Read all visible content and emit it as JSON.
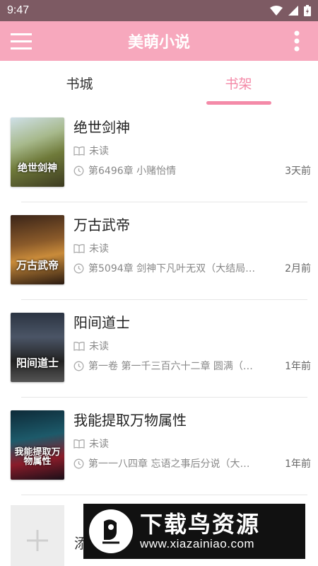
{
  "status": {
    "time": "9:47"
  },
  "app": {
    "title": "美萌小说"
  },
  "tabs": [
    {
      "label": "书城",
      "active": false
    },
    {
      "label": "书架",
      "active": true
    }
  ],
  "books": [
    {
      "title": "绝世剑神",
      "status": "未读",
      "chapter": "第6496章 小赌怡情",
      "time": "3天前",
      "cover_text": "绝世剑神",
      "cover_author": ""
    },
    {
      "title": "万古武帝",
      "status": "未读",
      "chapter": "第5094章 剑神下凡叶无双（大结局…",
      "time": "2月前",
      "cover_text": "万古武帝",
      "cover_author": ""
    },
    {
      "title": "阳间道士",
      "status": "未读",
      "chapter": "第一卷 第一千三百六十二章 圆满（…",
      "time": "1年前",
      "cover_text": "阳间道士",
      "cover_author": ""
    },
    {
      "title": "我能提取万物属性",
      "status": "未读",
      "chapter": "第一一八四章 忘语之事后分说（大…",
      "time": "1年前",
      "cover_text": "我能提取万物属性",
      "cover_author": ""
    }
  ],
  "add": {
    "label": "添"
  },
  "watermark": {
    "main": "下载鸟资源",
    "url": "www.xiazainiao.com"
  },
  "colors": {
    "accent": "#f48aa8",
    "appbar": "#f7a8bd",
    "statusbar": "#7d5a63"
  }
}
